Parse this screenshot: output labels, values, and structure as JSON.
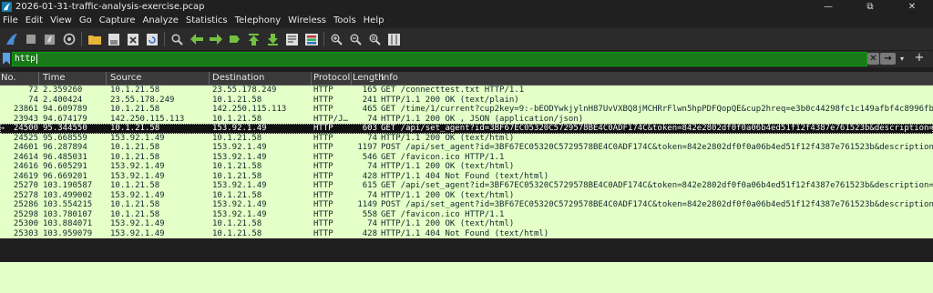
{
  "window": {
    "title": "2026-01-31-traffic-analysis-exercise.pcap",
    "minimize": "—",
    "maximize": "⧉",
    "close": "✕"
  },
  "menu": [
    "File",
    "Edit",
    "View",
    "Go",
    "Capture",
    "Analyze",
    "Statistics",
    "Telephony",
    "Wireless",
    "Tools",
    "Help"
  ],
  "toolbar_icons": [
    "shark-fin-start-icon",
    "stop-icon",
    "restart-icon",
    "capture-options-icon",
    "open-folder-icon",
    "save-icon",
    "close-file-icon",
    "reload-icon",
    "find-icon",
    "back-arrow-icon",
    "forward-arrow-icon",
    "go-to-packet-icon",
    "first-packet-icon",
    "last-packet-icon",
    "autoscroll-icon",
    "colorize-icon",
    "zoom-in-icon",
    "zoom-out-icon",
    "normal-size-icon",
    "resize-columns-icon"
  ],
  "filter": {
    "value": "http",
    "apply_label": "→",
    "clear_label": "✕",
    "dropdown_label": "▾",
    "add_label": "+"
  },
  "columns": [
    "No.",
    "Time",
    "Source",
    "Destination",
    "Protocol",
    "Length",
    "Info"
  ],
  "packets": [
    {
      "no": "72",
      "time": "2.359260",
      "src": "10.1.21.58",
      "dst": "23.55.178.249",
      "proto": "HTTP",
      "len": "165",
      "info": "GET /connecttest.txt HTTP/1.1",
      "selected": false
    },
    {
      "no": "74",
      "time": "2.400424",
      "src": "23.55.178.249",
      "dst": "10.1.21.58",
      "proto": "HTTP",
      "len": "241",
      "info": "HTTP/1.1 200 OK  (text/plain)",
      "selected": false
    },
    {
      "no": "23861",
      "time": "94.609789",
      "src": "10.1.21.58",
      "dst": "142.250.115.113",
      "proto": "HTTP",
      "len": "465",
      "info": "GET /time/1/current?cup2key=9:-bEODYwkjylnH87UvVXBQ8jMCHRrFlwn5hpPDFQopQE&cup2hreq=e3b0c44298fc1c149afbf4c8996fb…",
      "selected": false
    },
    {
      "no": "23943",
      "time": "94.674179",
      "src": "142.250.115.113",
      "dst": "10.1.21.58",
      "proto": "HTTP/J…",
      "len": "74",
      "info": "HTTP/1.1 200 OK , JSON (application/json)",
      "selected": false
    },
    {
      "no": "24500",
      "time": "95.344550",
      "src": "10.1.21.58",
      "dst": "153.92.1.49",
      "proto": "HTTP",
      "len": "603",
      "info": "GET /api/set_agent?id=3BF67EC05320C5729578BE4C0ADF174C&token=842e2802df0f0a06b4ed51f12f4387e761523b&description=…",
      "selected": true
    },
    {
      "no": "24525",
      "time": "95.668559",
      "src": "153.92.1.49",
      "dst": "10.1.21.58",
      "proto": "HTTP",
      "len": "74",
      "info": "HTTP/1.1 200 OK  (text/html)",
      "selected": false
    },
    {
      "no": "24601",
      "time": "96.287894",
      "src": "10.1.21.58",
      "dst": "153.92.1.49",
      "proto": "HTTP",
      "len": "1197",
      "info": "POST /api/set_agent?id=3BF67EC05320C5729578BE4C0ADF174C&token=842e2802df0f0a06b4ed51f12f4387e761523b&description…",
      "selected": false
    },
    {
      "no": "24614",
      "time": "96.485031",
      "src": "10.1.21.58",
      "dst": "153.92.1.49",
      "proto": "HTTP",
      "len": "546",
      "info": "GET /favicon.ico HTTP/1.1",
      "selected": false
    },
    {
      "no": "24616",
      "time": "96.605291",
      "src": "153.92.1.49",
      "dst": "10.1.21.58",
      "proto": "HTTP",
      "len": "74",
      "info": "HTTP/1.1 200 OK  (text/html)",
      "selected": false
    },
    {
      "no": "24619",
      "time": "96.669201",
      "src": "153.92.1.49",
      "dst": "10.1.21.58",
      "proto": "HTTP",
      "len": "428",
      "info": "HTTP/1.1 404 Not Found  (text/html)",
      "selected": false
    },
    {
      "no": "25270",
      "time": "103.190587",
      "src": "10.1.21.58",
      "dst": "153.92.1.49",
      "proto": "HTTP",
      "len": "615",
      "info": "GET /api/set_agent?id=3BF67EC05320C5729578BE4C0ADF174C&token=842e2802df0f0a06b4ed51f12f4387e761523b&description=…",
      "selected": false
    },
    {
      "no": "25278",
      "time": "103.499002",
      "src": "153.92.1.49",
      "dst": "10.1.21.58",
      "proto": "HTTP",
      "len": "74",
      "info": "HTTP/1.1 200 OK  (text/html)",
      "selected": false
    },
    {
      "no": "25286",
      "time": "103.554215",
      "src": "10.1.21.58",
      "dst": "153.92.1.49",
      "proto": "HTTP",
      "len": "1149",
      "info": "POST /api/set_agent?id=3BF67EC05320C5729578BE4C0ADF174C&token=842e2802df0f0a06b4ed51f12f4387e761523b&description…",
      "selected": false
    },
    {
      "no": "25298",
      "time": "103.780107",
      "src": "10.1.21.58",
      "dst": "153.92.1.49",
      "proto": "HTTP",
      "len": "558",
      "info": "GET /favicon.ico HTTP/1.1",
      "selected": false
    },
    {
      "no": "25300",
      "time": "103.884071",
      "src": "153.92.1.49",
      "dst": "10.1.21.58",
      "proto": "HTTP",
      "len": "74",
      "info": "HTTP/1.1 200 OK  (text/html)",
      "selected": false
    },
    {
      "no": "25303",
      "time": "103.959079",
      "src": "153.92.1.49",
      "dst": "10.1.21.58",
      "proto": "HTTP",
      "len": "428",
      "info": "HTTP/1.1 404 Not Found  (text/html)",
      "selected": false
    }
  ],
  "colors": {
    "http_row": "#e4ffc7",
    "selected_row": "#111111",
    "filter_valid": "#1a7a1a"
  }
}
